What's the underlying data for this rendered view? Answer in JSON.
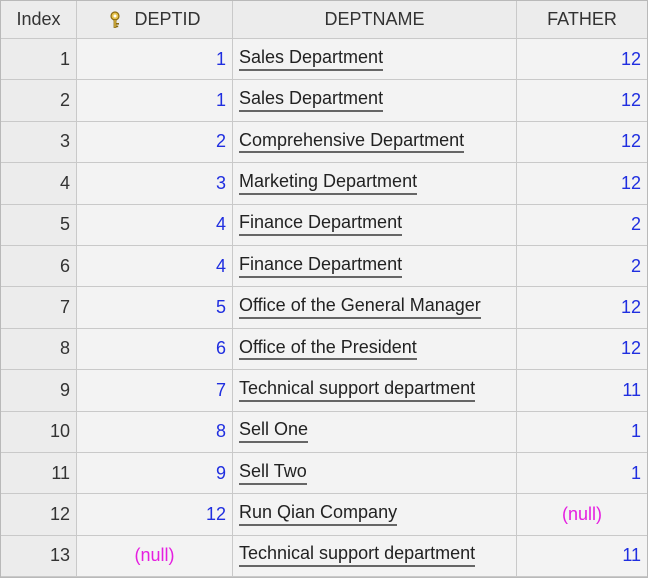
{
  "table": {
    "headers": {
      "index": "Index",
      "deptid": "DEPTID",
      "deptname": "DEPTNAME",
      "father": "FATHER"
    },
    "rows": [
      {
        "index": "1",
        "deptid": "1",
        "deptname": "Sales Department",
        "father": "12"
      },
      {
        "index": "2",
        "deptid": "1",
        "deptname": "Sales Department",
        "father": "12"
      },
      {
        "index": "3",
        "deptid": "2",
        "deptname": "Comprehensive Department",
        "father": "12"
      },
      {
        "index": "4",
        "deptid": "3",
        "deptname": "Marketing Department",
        "father": "12"
      },
      {
        "index": "5",
        "deptid": "4",
        "deptname": "Finance Department",
        "father": "2"
      },
      {
        "index": "6",
        "deptid": "4",
        "deptname": "Finance Department",
        "father": "2"
      },
      {
        "index": "7",
        "deptid": "5",
        "deptname": "Office of the General Manager",
        "father": "12"
      },
      {
        "index": "8",
        "deptid": "6",
        "deptname": "Office of the President",
        "father": "12"
      },
      {
        "index": "9",
        "deptid": "7",
        "deptname": "Technical support department",
        "father": "11"
      },
      {
        "index": "10",
        "deptid": "8",
        "deptname": "Sell One",
        "father": "1"
      },
      {
        "index": "11",
        "deptid": "9",
        "deptname": "Sell Two",
        "father": "1"
      },
      {
        "index": "12",
        "deptid": "12",
        "deptname": "Run Qian Company",
        "father": "(null)"
      },
      {
        "index": "13",
        "deptid": "(null)",
        "deptname": "Technical support department",
        "father": "11"
      }
    ]
  },
  "icons": {
    "primary_key": "key-icon"
  },
  "colors": {
    "number": "#1f2ee0",
    "null": "#e51ee0"
  }
}
